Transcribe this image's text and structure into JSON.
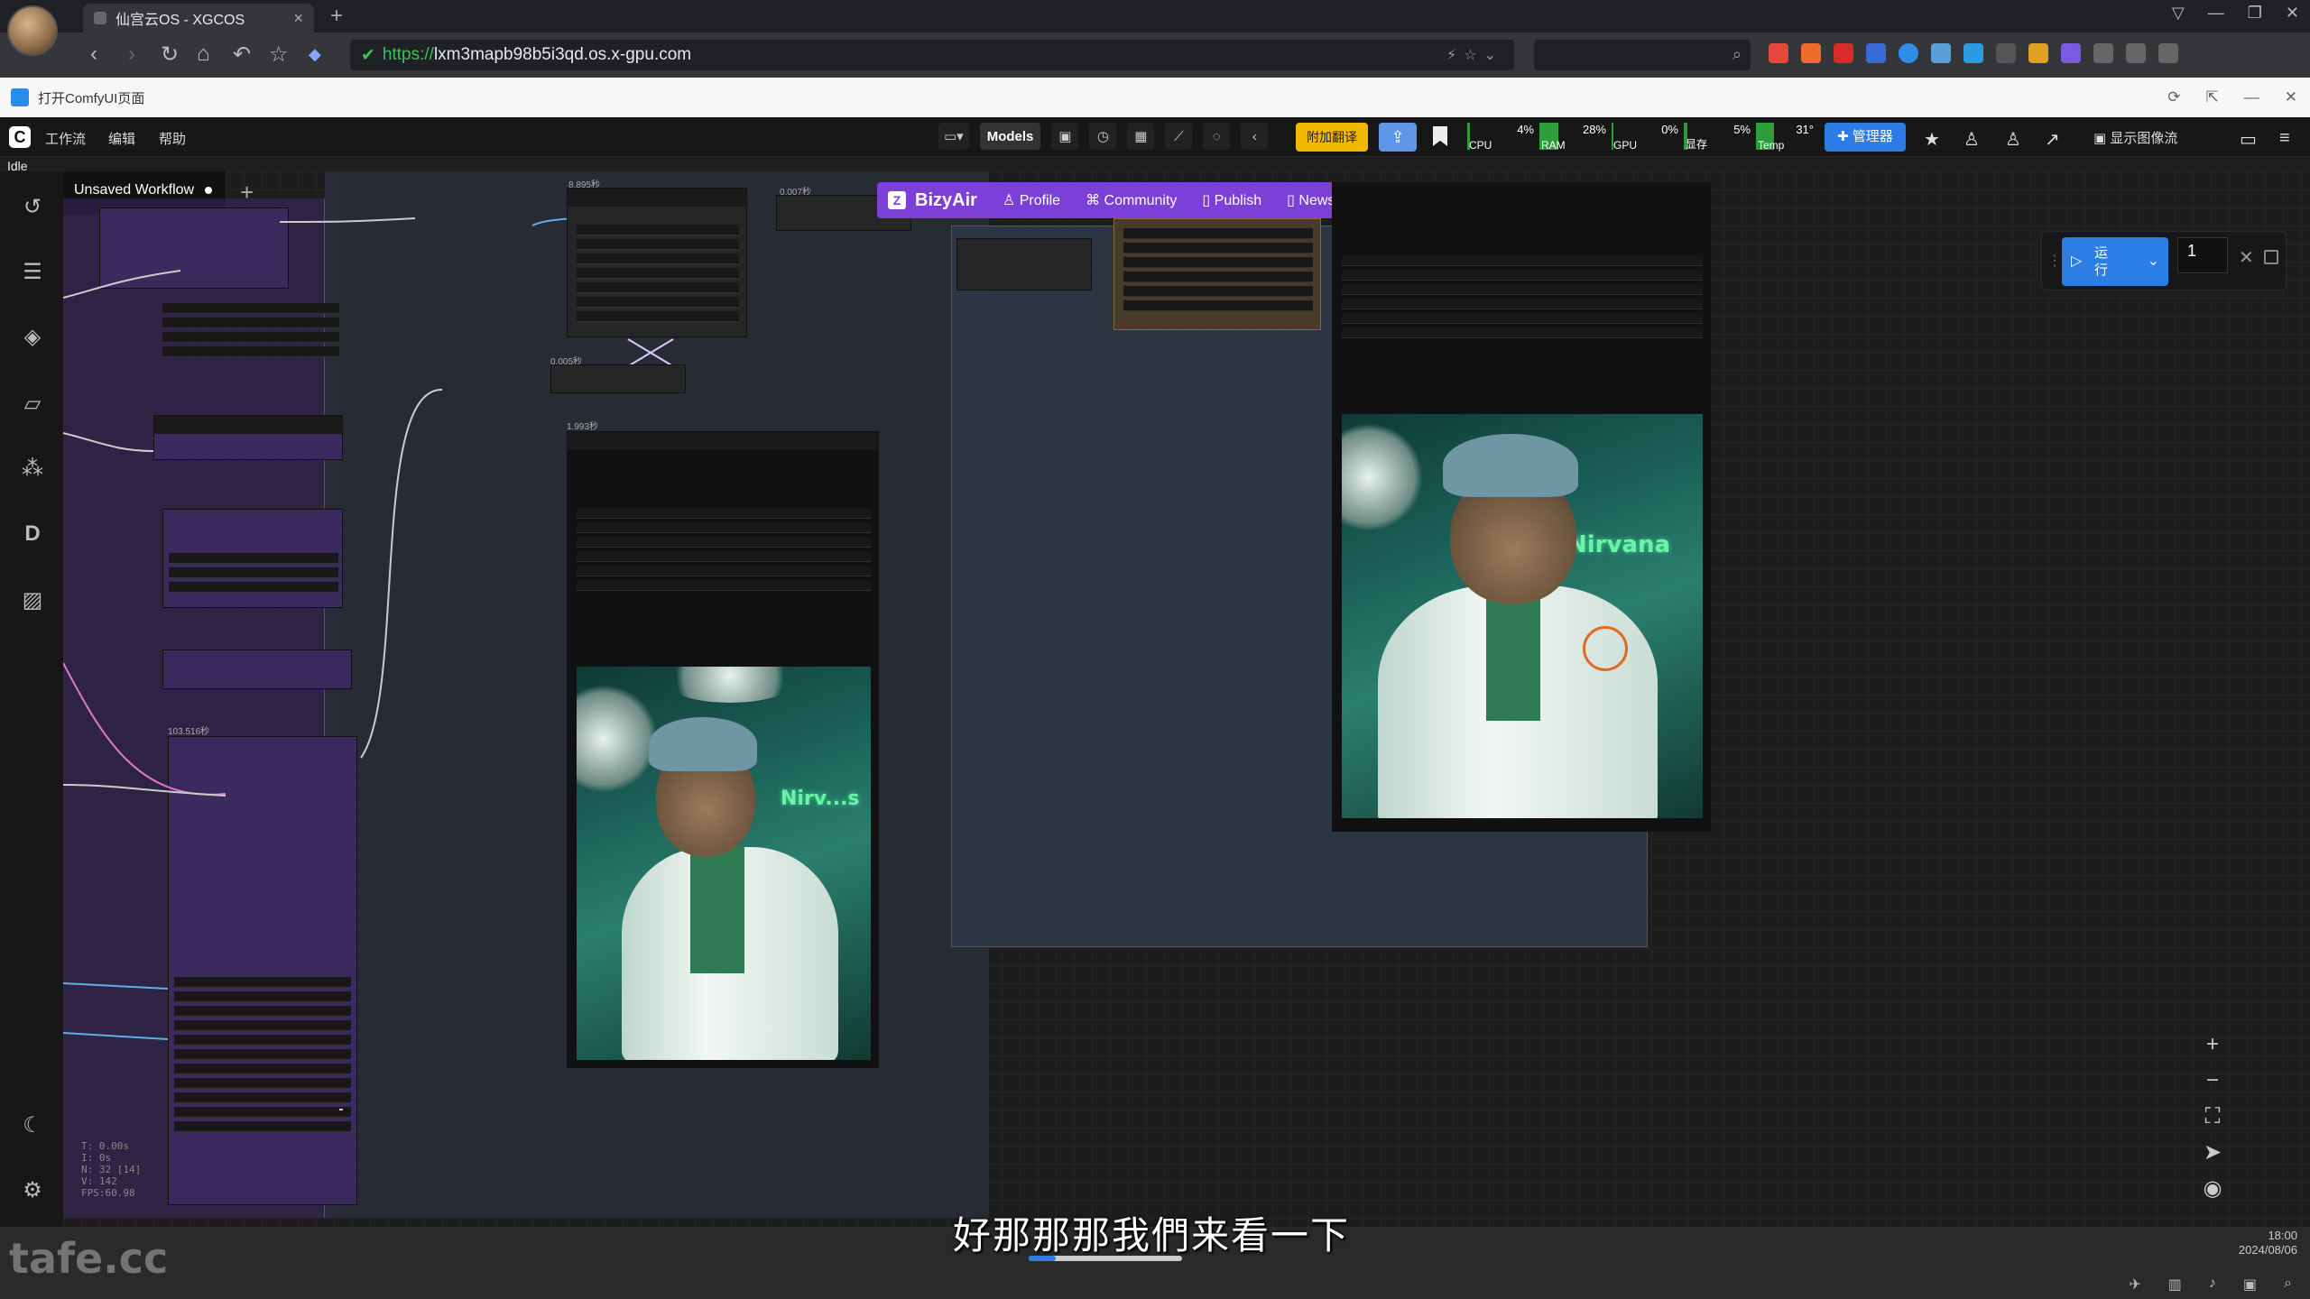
{
  "browser": {
    "tab_title": "仙宫云OS - XGCOS",
    "tab_close": "×",
    "new_tab": "+",
    "url_protocol": "https://",
    "url_rest": "lxm3mapb98b5i3qd.os.x-gpu.com",
    "window_controls": [
      "▽",
      "—",
      "❐",
      "✕"
    ]
  },
  "page_header": {
    "title": "打开ComfyUI页面",
    "controls": [
      "⟳",
      "⇱",
      "—",
      "✕"
    ]
  },
  "comfy_menu": {
    "items": [
      "工作流",
      "编辑",
      "帮助"
    ],
    "models_label": "Models",
    "translate_label": "附加翻译",
    "manager_label": "管理器",
    "show_image_label": "显示图像流",
    "monitors": [
      {
        "label": "CPU",
        "value": "4%",
        "level": 0.04
      },
      {
        "label": "RAM",
        "value": "28%",
        "level": 0.28
      },
      {
        "label": "GPU",
        "value": "0%",
        "level": 0.0
      },
      {
        "label": "显存",
        "value": "5%",
        "level": 0.05
      },
      {
        "label": "Temp",
        "value": "31°",
        "level": 0.31
      }
    ]
  },
  "status": "Idle",
  "workflow": {
    "tab_name": "Unsaved Workflow",
    "add_label": "+"
  },
  "bizyair": {
    "brand": "BizyAir",
    "items": [
      "Profile",
      "Community",
      "Publish",
      "News"
    ]
  },
  "run_panel": {
    "run_label": "运行",
    "batch_count": "1"
  },
  "node_timings": [
    "8.895秒",
    "0.007秒",
    "0.005秒",
    "1.993秒",
    "103.516秒"
  ],
  "preview_signs": [
    "Nirv...s",
    "Nirvana"
  ],
  "stats": [
    "T: 0.00s",
    "I: 0s",
    "N: 32 [14]",
    "V: 142",
    "FPS:60.98"
  ],
  "subtitle": "好那那那我們来看一下",
  "watermark": "tafe.cc",
  "clock": {
    "time": "18:00",
    "date": "2024/08/06"
  },
  "colors": {
    "accent_blue": "#2c7de4",
    "bizyair_purple": "#7c3fd8",
    "translate_yellow": "#f2b800",
    "monitor_green": "#2f9c3a",
    "group_purple": "#3a2a5e"
  }
}
